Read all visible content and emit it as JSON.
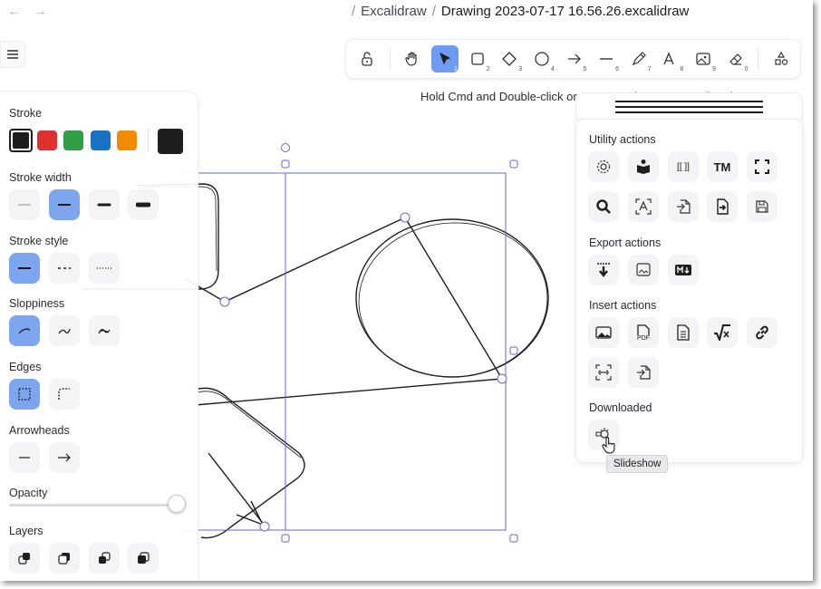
{
  "titlebar": {
    "back_label": "←",
    "forward_label": "→",
    "crumb1": "Excalidraw",
    "crumb2": "Drawing 2023-07-17 16.56.26.excalidraw",
    "sep": "/"
  },
  "toolbar": {
    "tools": [
      {
        "name": "lock",
        "key": ""
      },
      {
        "name": "hand",
        "key": ""
      },
      {
        "name": "selection",
        "key": "1"
      },
      {
        "name": "rectangle",
        "key": "2"
      },
      {
        "name": "diamond",
        "key": "3"
      },
      {
        "name": "ellipse",
        "key": "4"
      },
      {
        "name": "arrow",
        "key": "5"
      },
      {
        "name": "line",
        "key": "6"
      },
      {
        "name": "draw",
        "key": "7"
      },
      {
        "name": "text",
        "key": "8"
      },
      {
        "name": "image",
        "key": "9"
      },
      {
        "name": "eraser",
        "key": "0"
      },
      {
        "name": "more-shapes",
        "key": ""
      }
    ]
  },
  "hint": "Hold Cmd and Double-click or press Cmd + Enter to edit points",
  "props": {
    "stroke": "Stroke",
    "stroke_width": "Stroke width",
    "stroke_style": "Stroke style",
    "sloppiness": "Sloppiness",
    "edges": "Edges",
    "arrowheads": "Arrowheads",
    "opacity": "Opacity",
    "layers": "Layers",
    "colors": [
      "#1e1e1e",
      "#e03131",
      "#2f9e44",
      "#1971c2",
      "#f08c00"
    ],
    "current_color": "#1e1e1e",
    "accent": "#7ea6ee",
    "opacity_value": 100
  },
  "panel": {
    "utility": "Utility actions",
    "export": "Export actions",
    "insert": "Insert actions",
    "downloaded": "Downloaded",
    "tm": "TM",
    "brackets": "[[ ]]",
    "pdf": "PDF"
  },
  "tooltip": "Slideshow"
}
